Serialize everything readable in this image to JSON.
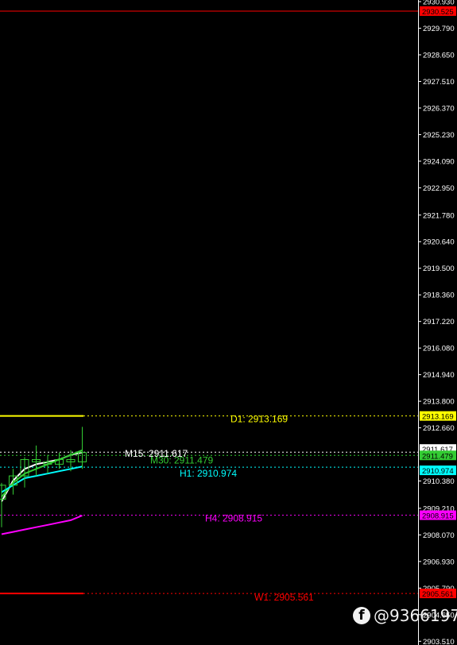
{
  "chart_data": {
    "type": "candlestick",
    "ylim": [
      2903.35,
      2931.0
    ],
    "yticks": [
      "2930.930",
      "2929.790",
      "2928.650",
      "2927.510",
      "2926.370",
      "2925.230",
      "2924.090",
      "2922.950",
      "2921.780",
      "2920.640",
      "2919.500",
      "2918.360",
      "2917.220",
      "2916.080",
      "2914.940",
      "2913.800",
      "2912.660",
      "2910.380",
      "2909.210",
      "2908.070",
      "2906.930",
      "2905.790",
      "2904.650",
      "2903.510"
    ],
    "candles": [
      {
        "o": 2909.6,
        "h": 2910.3,
        "l": 2908.4,
        "c": 2910.2
      },
      {
        "o": 2910.2,
        "h": 2910.9,
        "l": 2909.8,
        "c": 2910.6
      },
      {
        "o": 2910.6,
        "h": 2911.4,
        "l": 2910.1,
        "c": 2911.3
      },
      {
        "o": 2911.3,
        "h": 2911.9,
        "l": 2910.6,
        "c": 2911.2
      },
      {
        "o": 2911.2,
        "h": 2911.5,
        "l": 2910.7,
        "c": 2911.1
      },
      {
        "o": 2911.1,
        "h": 2911.6,
        "l": 2910.9,
        "c": 2911.3
      },
      {
        "o": 2911.3,
        "h": 2911.7,
        "l": 2910.8,
        "c": 2911.2
      },
      {
        "o": 2911.2,
        "h": 2912.7,
        "l": 2910.9,
        "c": 2911.6
      }
    ],
    "levels": [
      {
        "name": "D1",
        "label": "D1: 2913.169",
        "tag": "2913.169",
        "value": 2913.169,
        "color": "#ffff00",
        "tagText": "#000000"
      },
      {
        "name": "M15",
        "label": "M15: 2911.617",
        "tag": "2911.617",
        "value": 2911.617,
        "color": "#ffffff",
        "tagText": "#000000"
      },
      {
        "name": "M30",
        "label": "M30: 2911.479",
        "tag": "2911.479",
        "value": 2911.479,
        "color": "#33cc33",
        "tagText": "#000000"
      },
      {
        "name": "H1",
        "label": "H1: 2910.974",
        "tag": "2910.974",
        "value": 2910.974,
        "color": "#00ffff",
        "tagText": "#000000"
      },
      {
        "name": "H4",
        "label": "H4: 2908.915",
        "tag": "2908.915",
        "value": 2908.915,
        "color": "#ff00ff",
        "tagText": "#000000"
      },
      {
        "name": "W1",
        "label": "W1: 2905.561",
        "tag": "2905.561",
        "value": 2905.561,
        "color": "#ff0000",
        "tagText": "#000000"
      },
      {
        "name": "top",
        "label": "",
        "tag": "2930.525",
        "value": 2930.525,
        "color": "#ff0000",
        "tagText": "#000000"
      }
    ],
    "ma_lines": [
      {
        "name": "white-ma",
        "color": "#ffffff",
        "values": [
          2909.5,
          2910.4,
          2910.9,
          2911.1,
          2911.2,
          2911.3,
          2911.5,
          2911.6
        ]
      },
      {
        "name": "green-ma",
        "color": "#33cc33",
        "values": [
          2909.7,
          2910.3,
          2910.7,
          2910.9,
          2911.1,
          2911.3,
          2911.5,
          2911.7
        ]
      },
      {
        "name": "cyan-ma",
        "color": "#00ffff",
        "values": [
          2909.9,
          2910.2,
          2910.5,
          2910.6,
          2910.7,
          2910.8,
          2910.9,
          2911.0
        ]
      },
      {
        "name": "magenta-ma",
        "color": "#ff00ff",
        "values": [
          2908.1,
          2908.2,
          2908.3,
          2908.4,
          2908.5,
          2908.6,
          2908.7,
          2908.9
        ]
      }
    ],
    "colors": {
      "background": "#000000",
      "axis": "#ffffff",
      "up": "#33cc33",
      "down": "#33cc33"
    }
  },
  "watermark": {
    "icon": "facebook-icon",
    "text": "@9366197"
  }
}
